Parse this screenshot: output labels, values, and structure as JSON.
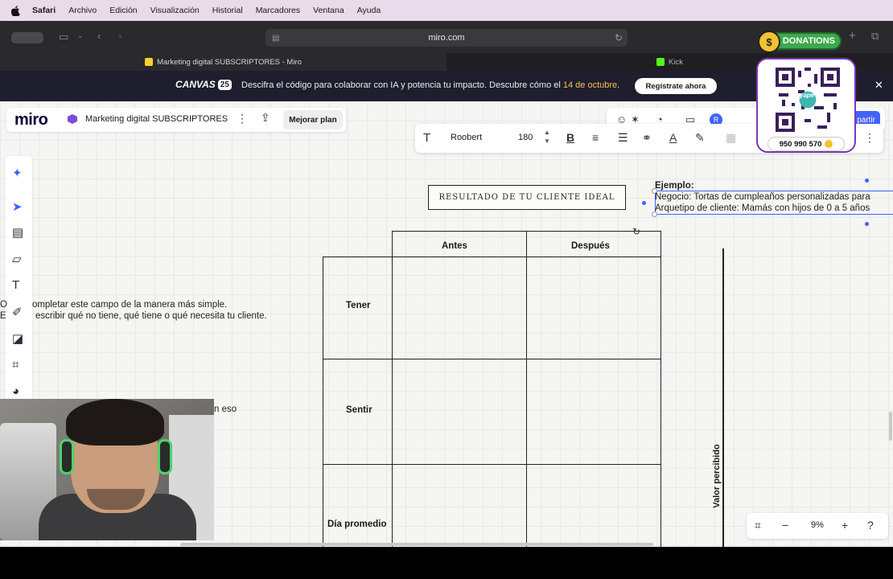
{
  "menubar": {
    "items": [
      "Safari",
      "Archivo",
      "Edición",
      "Visualización",
      "Historial",
      "Marcadores",
      "Ventana",
      "Ayuda"
    ]
  },
  "browser": {
    "address": "miro.com",
    "tabs": [
      {
        "label": "Marketing digital SUBSCRIPTORES - Miro",
        "active": true
      },
      {
        "label": "Kick",
        "active": false
      }
    ]
  },
  "banner": {
    "logo": "CANVAS",
    "logo_num": "25",
    "text": "Descifra el código para colaborar con IA y potencia tu impacto. Descubre cómo el ",
    "date": "14 de octubre",
    "text_end": ".",
    "button": "Regístrate ahora",
    "close": "✕"
  },
  "board": {
    "logo": "miro",
    "title": "Marketing digital SUBSCRIPTORES",
    "upgrade": "Mejorar plan",
    "avatar": "R",
    "share": "partir"
  },
  "text_toolbar": {
    "font": "Roobert",
    "size": "180"
  },
  "content": {
    "title_box": "RESULTADO DE TU CLIENTE IDEAL",
    "example_heading": "Ejemplo:",
    "example_line1": "Negocio: Tortas de cumpleaños personalizadas para",
    "example_line2": "Arquetipo de cliente: Mamás con hijos de 0 a 5 años",
    "col_before": "Antes",
    "col_after": "Después",
    "row_have": "Tener",
    "row_feel": "Sentir",
    "row_day": "Día promedio",
    "left_note_line1": "ompletar este campo de la manera más simple.",
    "left_note_line2": "escribir qué no tiene, qué tiene o qué necesita tu cliente.",
    "left_note2": "n eso",
    "axis_label": "Valor percibido"
  },
  "zoom": {
    "value": "9%"
  },
  "overlay": {
    "donations": "DONATIONS",
    "phone": "950 990 570",
    "qr_brand": "yape"
  },
  "colors": {
    "accent": "#4262ff",
    "banner_bg": "#1f1e2e",
    "banner_highlight": "#f4c14b",
    "donations_green": "#3ea84b"
  }
}
